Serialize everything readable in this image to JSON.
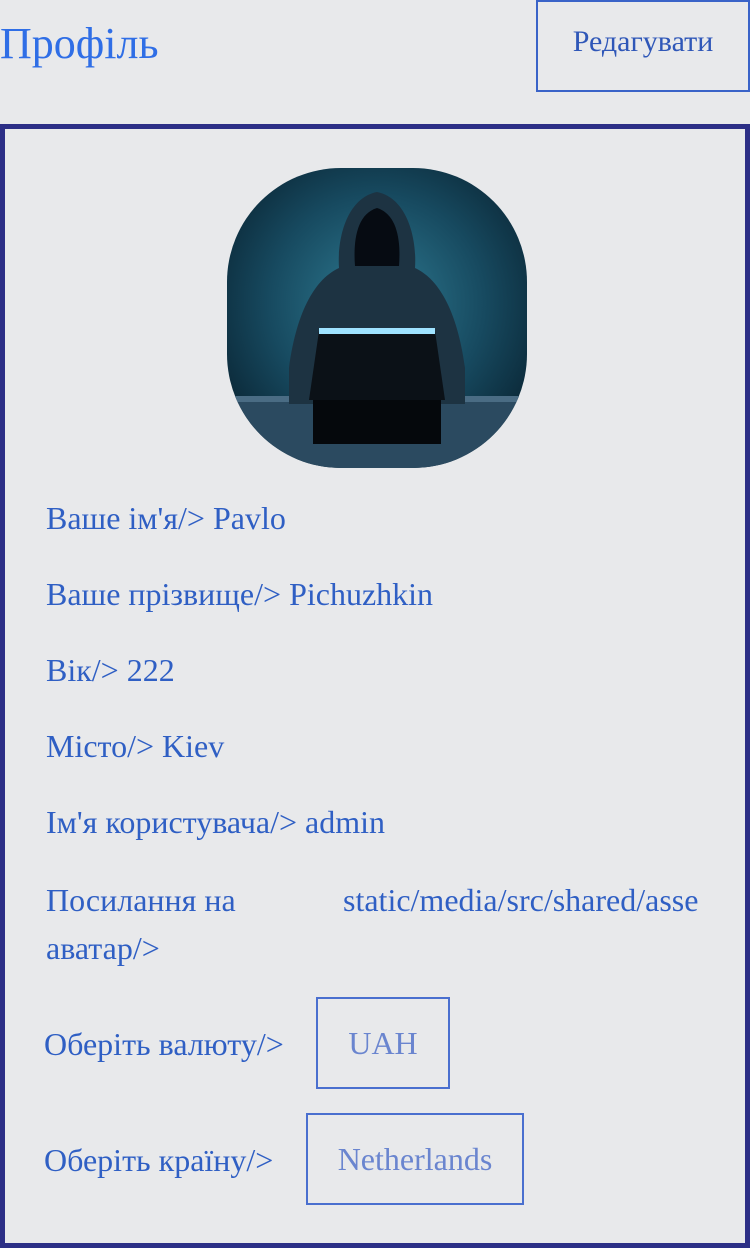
{
  "header": {
    "title": "Профіль",
    "edit_label": "Редагувати"
  },
  "profile": {
    "fields": [
      {
        "label": "Ваше ім'я/>",
        "value": "Pavlo"
      },
      {
        "label": "Ваше прізвище/>",
        "value": "Pichuzhkin"
      },
      {
        "label": "Вік/>",
        "value": "222"
      },
      {
        "label": "Місто/>",
        "value": "Kiev"
      },
      {
        "label": "Ім'я користувача/>",
        "value": "admin"
      }
    ],
    "avatar_link": {
      "label": "Посилання на аватар/>",
      "value": "static/media/src/shared/asse"
    },
    "currency": {
      "label": "Оберіть валюту/>",
      "selected": "UAH"
    },
    "country": {
      "label": "Оберіть країну/>",
      "selected": "Netherlands"
    }
  },
  "colors": {
    "background": "#e8e9eb",
    "accent": "#2f6ee6",
    "card_border": "#2c2f86",
    "text": "#2f5fc4"
  },
  "icons": {
    "avatar": "hooded-hacker-avatar-image"
  }
}
